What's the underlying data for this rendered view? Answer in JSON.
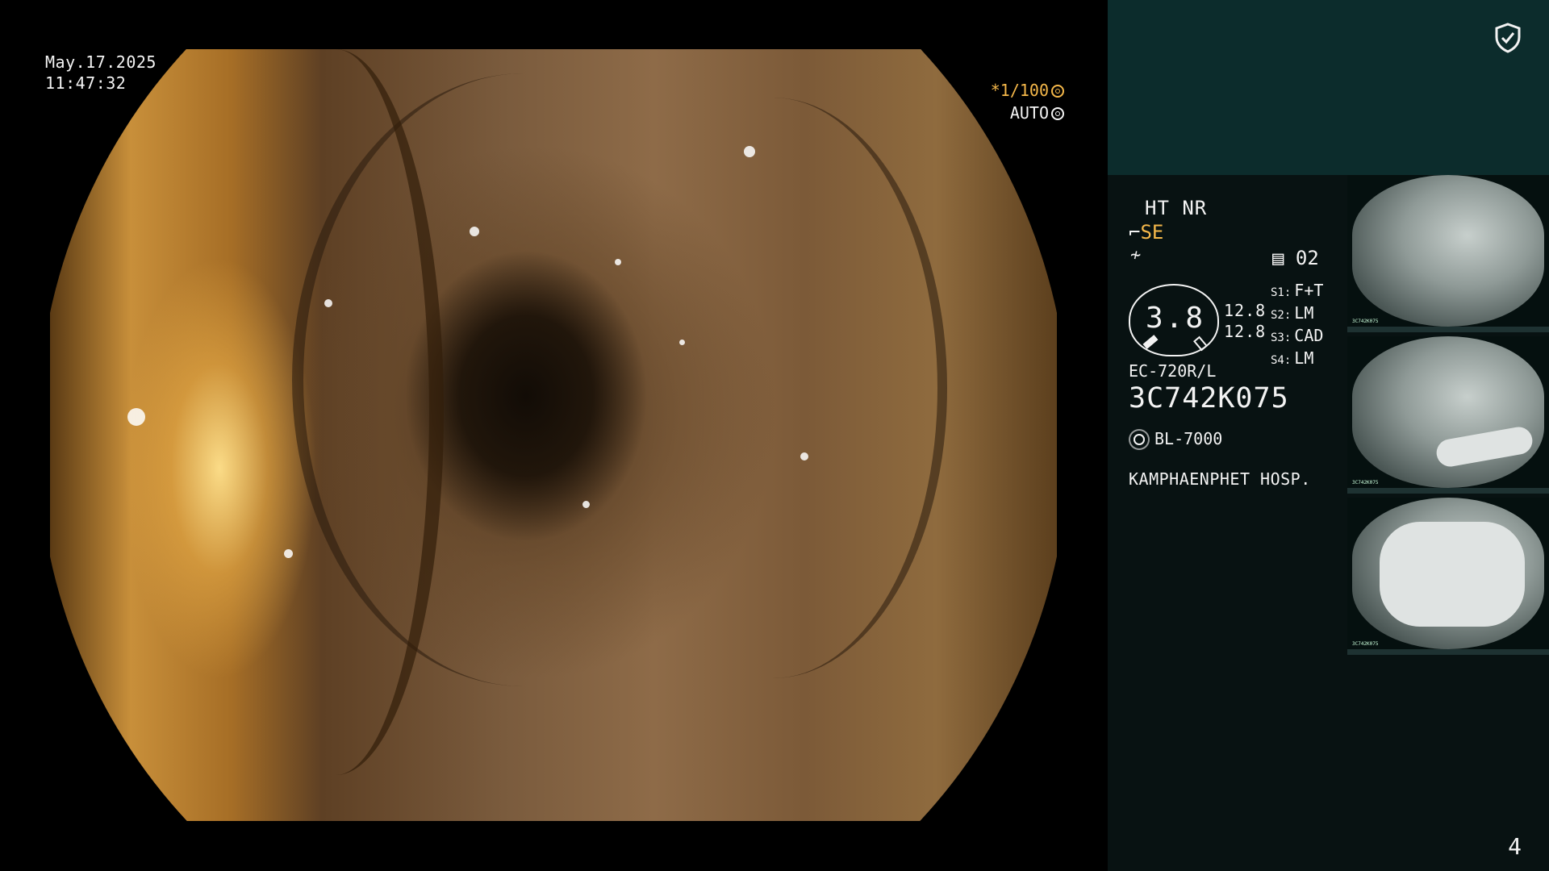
{
  "datetime": {
    "date": "May.17.2025",
    "time": "11:47:32"
  },
  "scope_status": {
    "shutter": "*1/100",
    "mode": "AUTO"
  },
  "info": {
    "enhancement": "HT NR",
    "structure_enhancement": "SE",
    "recording_label": "02",
    "brightness": "3.8",
    "gain_values": [
      "12.8",
      "12.8"
    ],
    "switches": [
      {
        "key": "S1:",
        "value": "F+T"
      },
      {
        "key": "S2:",
        "value": "LM"
      },
      {
        "key": "S3:",
        "value": "CAD"
      },
      {
        "key": "S4:",
        "value": "LM"
      }
    ],
    "scope_model": "EC-720R/L",
    "serial": "3C742K075",
    "light_source": "BL-7000",
    "hospital": "KAMPHAENPHET HOSP."
  },
  "thumbnails": [
    {
      "label": "3C742K075",
      "content": "scope-check"
    },
    {
      "label": "3C742K075",
      "content": "glove-partial"
    },
    {
      "label": "3C742K075",
      "content": "glove-full"
    }
  ],
  "page_number": "4",
  "colors": {
    "accent_amber": "#f5b84a",
    "panel_top": "#0c2c2c",
    "panel_bg": "#081212"
  },
  "icons": [
    "shield-check-icon",
    "shutter-icon",
    "auto-iris-icon",
    "freeze-icon",
    "scope-icon",
    "recording-icon",
    "light-source-icon"
  ]
}
